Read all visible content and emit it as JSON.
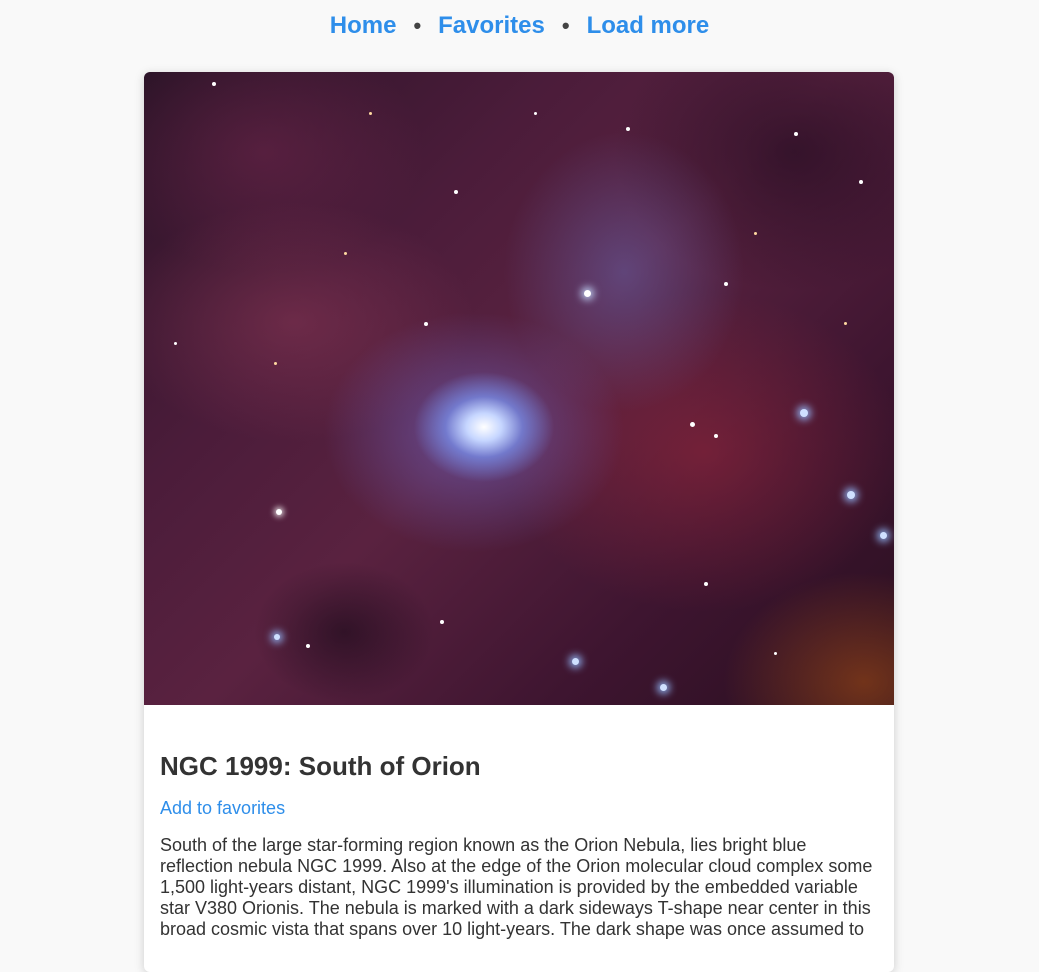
{
  "nav": {
    "home": "Home",
    "favorites": "Favorites",
    "load_more": "Load more",
    "separator": "•"
  },
  "post": {
    "title": "NGC 1999: South of Orion",
    "favorite_action": "Add to favorites",
    "description": "South of the large star-forming region known as the Orion Nebula, lies bright blue reflection nebula NGC 1999. Also at the edge of the Orion molecular cloud complex some 1,500 light-years distant, NGC 1999's illumination is provided by the embedded variable star V380 Orionis. The nebula is marked with a dark sideways T-shape near center in this broad cosmic vista that spans over 10 light-years. The dark shape was once assumed to"
  },
  "colors": {
    "link": "#2e8eea",
    "text": "#333333",
    "background": "#f9f9f9"
  }
}
